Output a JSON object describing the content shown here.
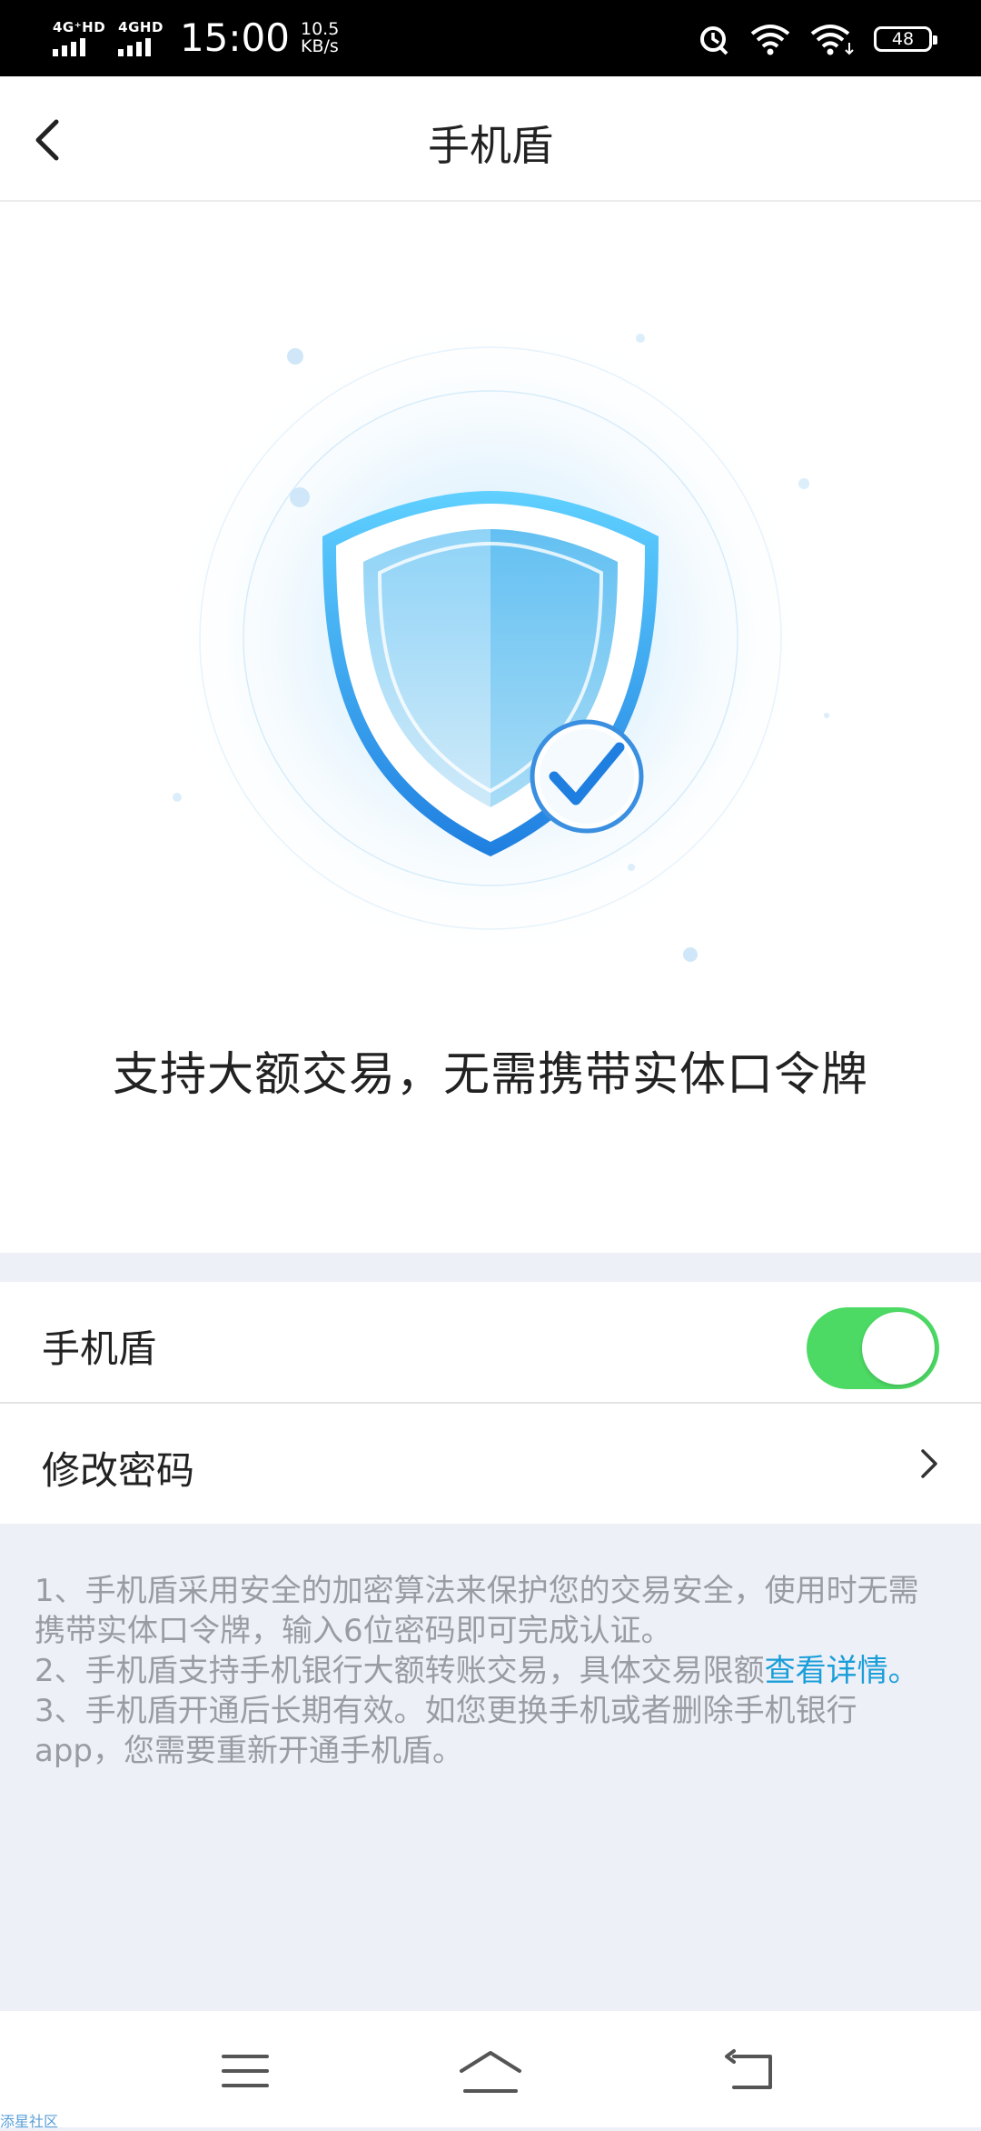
{
  "status_bar": {
    "network1": "4G⁺HD",
    "network2": "4GHD",
    "time": "15:00",
    "speed_value": "10.5",
    "speed_unit": "KB/s",
    "battery": "48"
  },
  "header": {
    "title": "手机盾"
  },
  "hero": {
    "slogan": "支持大额交易，无需携带实体口令牌"
  },
  "settings": {
    "toggle_label": "手机盾",
    "toggle_on": true,
    "change_password_label": "修改密码"
  },
  "notes": {
    "item1": "1、手机盾采用安全的加密算法来保护您的交易安全，使用时无需携带实体口令牌，输入6位密码即可完成认证。",
    "item2_prefix": "2、手机盾支持手机银行大额转账交易，具体交易限额",
    "item2_link": "查看详情",
    "item2_suffix": "。",
    "item3": "3、手机盾开通后长期有效。如您更换手机或者删除手机银行app，您需要重新开通手机盾。"
  },
  "colors": {
    "toggle_on": "#4cd964",
    "link": "#1a9ed9",
    "shield_blue": "#2f9ff0"
  },
  "watermark": "添星社区"
}
